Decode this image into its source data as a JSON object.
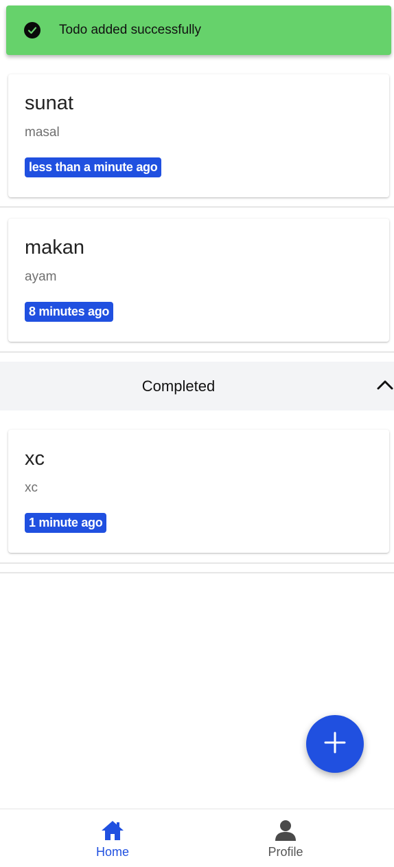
{
  "toast": {
    "message": "Todo added successfully",
    "icon": "check-circle-icon",
    "color": "#66d26b"
  },
  "todos": [
    {
      "title": "sunat",
      "description": "masal",
      "time": "less than a minute ago"
    },
    {
      "title": "makan",
      "description": "ayam",
      "time": "8 minutes ago"
    }
  ],
  "completed": {
    "header": "Completed",
    "expanded": true,
    "items": [
      {
        "title": "xc",
        "description": "xc",
        "time": "1 minute ago"
      }
    ]
  },
  "fab": {
    "icon": "plus-icon",
    "color": "#2050e0"
  },
  "bottom_nav": {
    "items": [
      {
        "label": "Home",
        "icon": "home-icon",
        "active": true
      },
      {
        "label": "Profile",
        "icon": "person-icon",
        "active": false
      }
    ]
  },
  "colors": {
    "accent": "#2050e0",
    "badge": "#2050e0"
  }
}
